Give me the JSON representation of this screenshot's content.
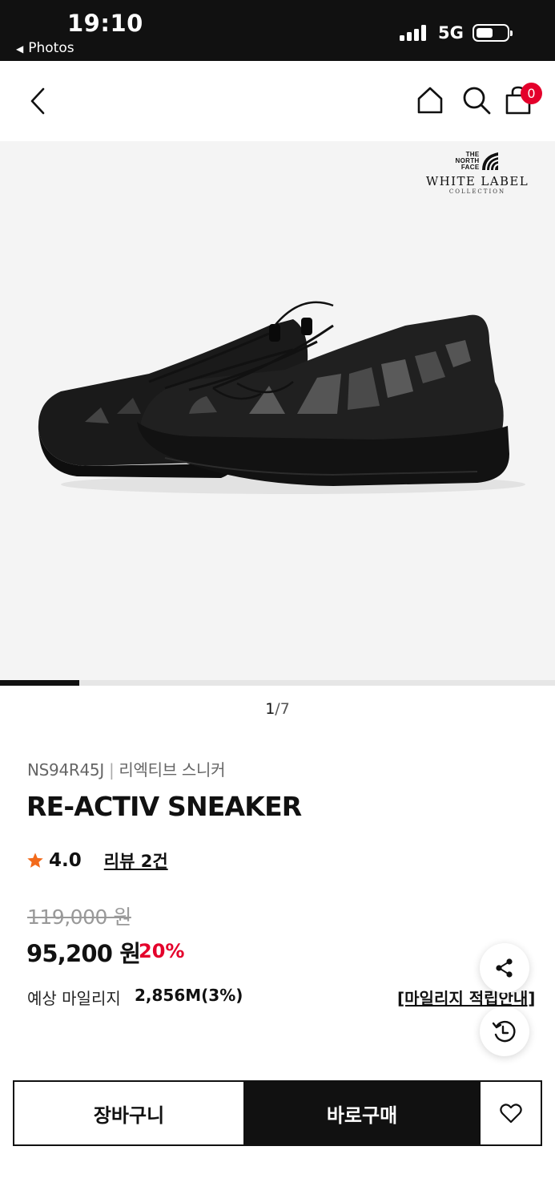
{
  "status_bar": {
    "time": "19:10",
    "back_app": "Photos",
    "network": "5G",
    "icons": [
      "signal-icon",
      "battery-icon"
    ]
  },
  "header": {
    "icons": [
      "chevron-left-icon",
      "home-icon",
      "search-icon",
      "shopping-bag-icon"
    ],
    "cart_count": "0"
  },
  "gallery": {
    "brand_mark": [
      "THE",
      "NORTH",
      "FACE"
    ],
    "brand_label": "WHITE LABEL",
    "brand_sublabel": "COLLECTION",
    "current_page": "1",
    "total_pages": "/7",
    "progress": 0.142857
  },
  "product": {
    "code": "NS94R45J",
    "separator": "|",
    "korean_name": "리엑티브 스니커",
    "name": "RE-ACTIV SNEAKER",
    "rating": "4.0",
    "review_link": "리뷰 2건",
    "original_price": "119,000 원",
    "sale_price": "95,200 원",
    "discount": "20%",
    "mileage_label": "예상 마일리지",
    "mileage_value": "2,856M(3%)",
    "mileage_guide": "[마일리지 적립안내]"
  },
  "colors": {
    "accent_red": "#e4002b",
    "dark": "#111111",
    "star_orange": "#f26a1b"
  },
  "actions": {
    "add_to_cart": "장바구니",
    "buy_now": "바로구매",
    "icons": [
      "share-icon",
      "history-icon",
      "heart-icon"
    ]
  }
}
